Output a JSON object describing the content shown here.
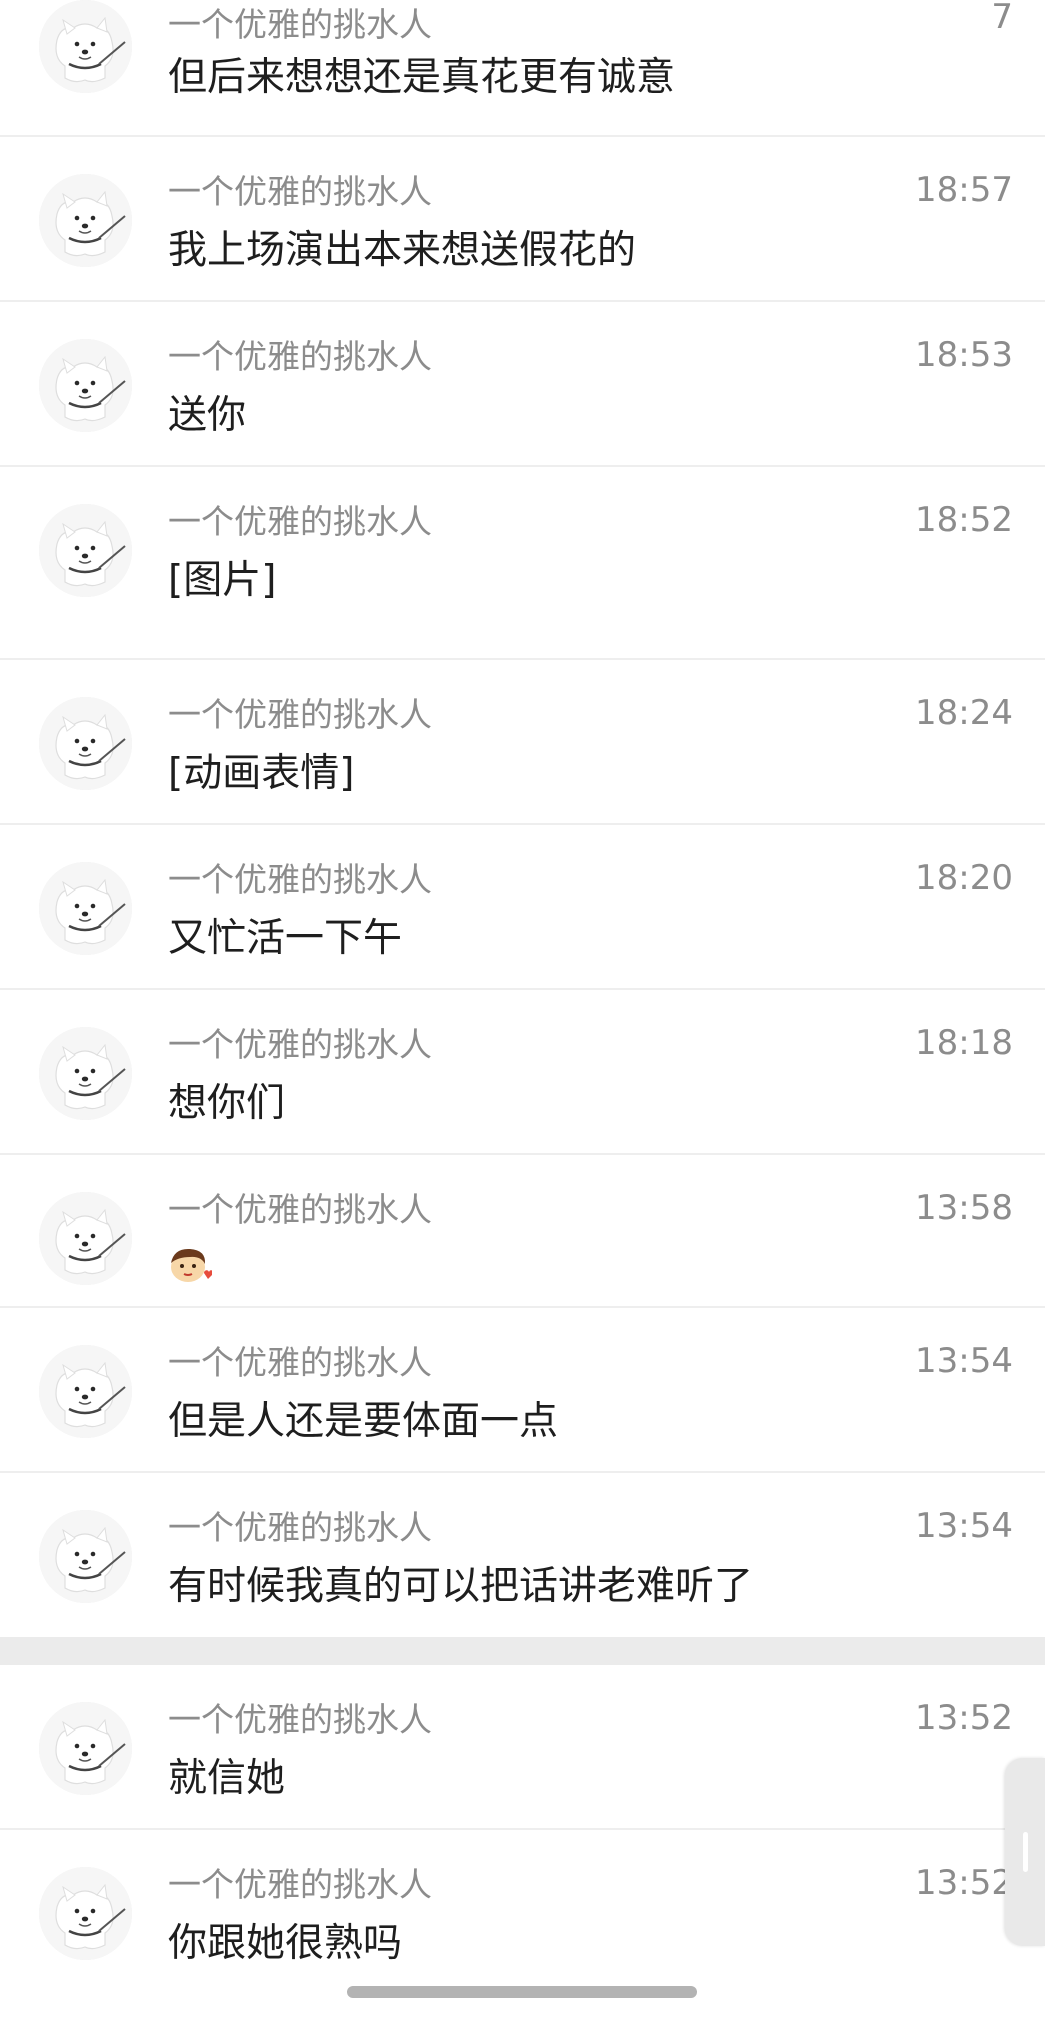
{
  "messages": [
    {
      "sender": "一个优雅的挑水人",
      "text": "但后来想想还是真花更有诚意",
      "time": "7"
    },
    {
      "sender": "一个优雅的挑水人",
      "text": "我上场演出本来想送假花的",
      "time": "18:57"
    },
    {
      "sender": "一个优雅的挑水人",
      "text": "送你",
      "time": "18:53"
    },
    {
      "sender": "一个优雅的挑水人",
      "text": "[图片]",
      "time": "18:52"
    },
    {
      "sender": "一个优雅的挑水人",
      "text": "[动画表情]",
      "time": "18:24"
    },
    {
      "sender": "一个优雅的挑水人",
      "text": "又忙活一下午",
      "time": "18:20"
    },
    {
      "sender": "一个优雅的挑水人",
      "text": "想你们",
      "time": "18:18"
    },
    {
      "sender": "一个优雅的挑水人",
      "text": "",
      "time": "13:58",
      "icon": "emoji-face-kiss-icon"
    },
    {
      "sender": "一个优雅的挑水人",
      "text": "但是人还是要体面一点",
      "time": "13:54"
    },
    {
      "sender": "一个优雅的挑水人",
      "text": "有时候我真的可以把话讲老难听了",
      "time": "13:54"
    },
    {
      "sender": "一个优雅的挑水人",
      "text": "就信她",
      "time": "13:52"
    },
    {
      "sender": "一个优雅的挑水人",
      "text": "你跟她很熟吗",
      "time": "13:52"
    }
  ],
  "avatar_icon": "samoyed-dog-avatar-icon",
  "colors": {
    "sender": "#8c8c8c",
    "message": "#1e1e1e",
    "time": "#8c8c8c",
    "divider": "#ebebeb",
    "row_border": "#eeeeee"
  }
}
